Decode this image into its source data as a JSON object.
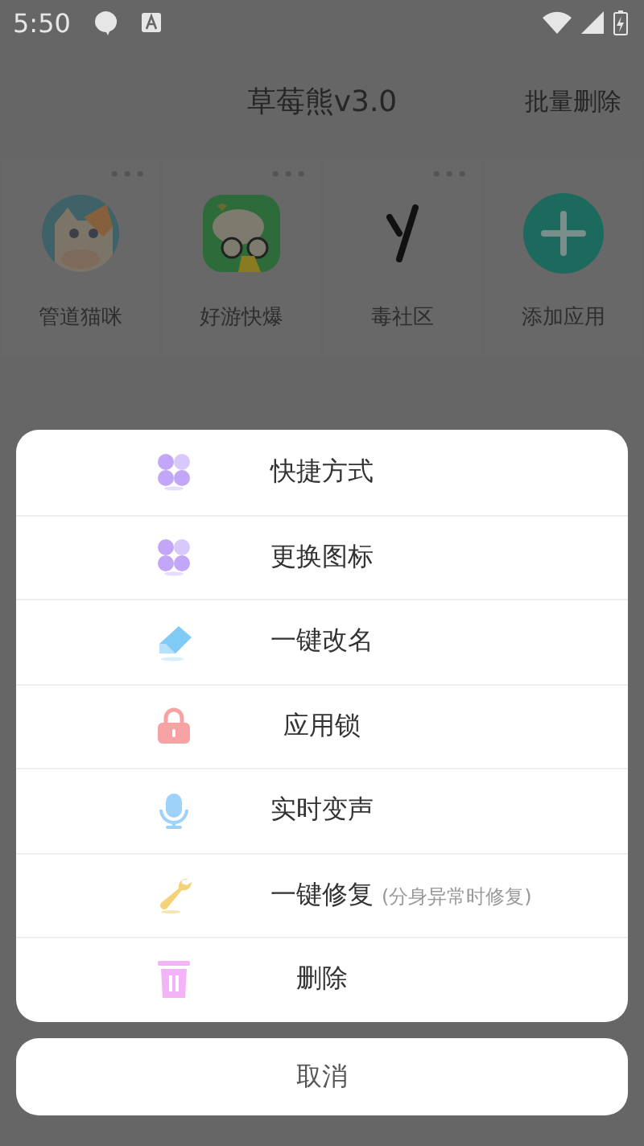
{
  "status_bar": {
    "time": "5:50"
  },
  "app_bar": {
    "title": "草莓熊v3.0",
    "action": "批量删除"
  },
  "apps": [
    {
      "kind": "cat",
      "label": "管道猫咪"
    },
    {
      "kind": "game",
      "label": "好游快爆"
    },
    {
      "kind": "letter",
      "label": "毒社区"
    },
    {
      "kind": "add",
      "label": "添加应用"
    }
  ],
  "action_sheet": {
    "items": [
      {
        "kind": "shortcut",
        "label": "快捷方式"
      },
      {
        "kind": "icon",
        "label": "更换图标"
      },
      {
        "kind": "rename",
        "label": "一键改名"
      },
      {
        "kind": "lock",
        "label": "应用锁"
      },
      {
        "kind": "voice",
        "label": "实时变声"
      },
      {
        "kind": "repair",
        "label": "一键修复",
        "hint": "(分身异常时修复)"
      },
      {
        "kind": "delete",
        "label": "删除"
      }
    ],
    "cancel": "取消"
  }
}
